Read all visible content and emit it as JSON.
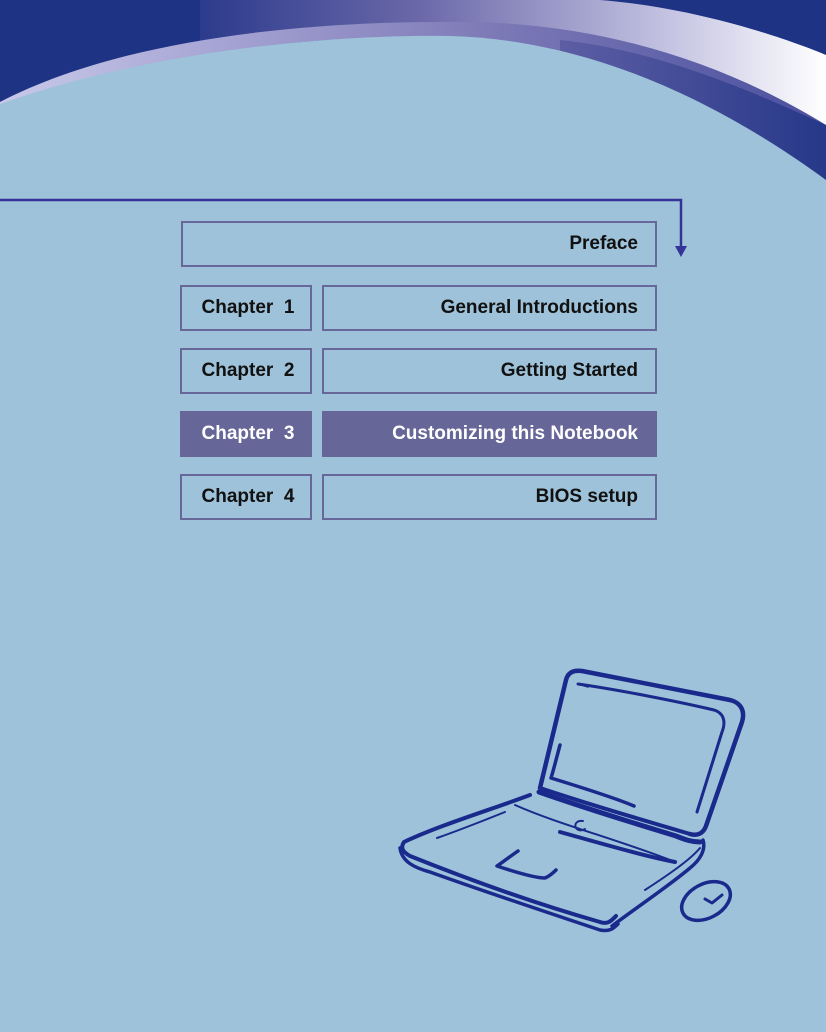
{
  "colors": {
    "background": "#9dc2d9",
    "header_navy": "#1e3384",
    "box_border": "#67679a",
    "active_fill": "#666699",
    "connector_line": "#333399",
    "drawing_stroke": "#1a2a8c"
  },
  "nav": {
    "preface": {
      "label": "Preface"
    },
    "chapters": [
      {
        "number_label": "Chapter  1",
        "title": "General Introductions",
        "active": false
      },
      {
        "number_label": "Chapter  2",
        "title": "Getting Started",
        "active": false
      },
      {
        "number_label": "Chapter  3",
        "title": "Customizing this Notebook",
        "active": true
      },
      {
        "number_label": "Chapter  4",
        "title": "BIOS setup",
        "active": false
      }
    ]
  },
  "decorations": {
    "header_graphic": "curved-wave-banner",
    "connector": "arrow-down-icon",
    "illustration": "laptop-with-mouse-sketch"
  }
}
